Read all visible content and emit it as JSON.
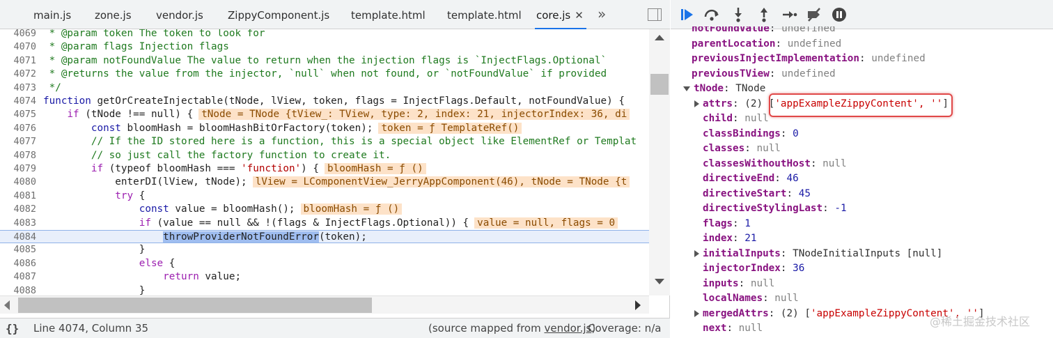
{
  "tabs": [
    {
      "label": "main.js"
    },
    {
      "label": "zone.js"
    },
    {
      "label": "vendor.js"
    },
    {
      "label": "ZippyComponent.js"
    },
    {
      "label": "template.html"
    },
    {
      "label": "template.html"
    },
    {
      "label": "core.js",
      "active": true,
      "close": "✕"
    }
  ],
  "tab_overflow": "»",
  "code_lines": [
    {
      "n": "4069",
      "text": " * @param token The token to look for"
    },
    {
      "n": "4070",
      "text": " * @param flags Injection flags"
    },
    {
      "n": "4071",
      "text": " * @param notFoundValue The value to return when the injection flags is `InjectFlags.Optional`"
    },
    {
      "n": "4072",
      "text": " * @returns the value from the injector, `null` when not found, or `notFoundValue` if provided"
    },
    {
      "n": "4073",
      "text": " */"
    },
    {
      "n": "4074",
      "kw": "function",
      "text": " getOrCreateInjectable(tNode, lView, token, flags = InjectFlags.Default, notFoundValue) {"
    },
    {
      "n": "4075",
      "pre": "    ",
      "kw": "if",
      "text": " (tNode !== null) {",
      "inline": "tNode = TNode {tView_: TView, type: 2, index: 21, injectorIndex: 36, di"
    },
    {
      "n": "4076",
      "pre": "        ",
      "kw": "const",
      "text": " bloomHash = bloomHashBitOrFactory(token);",
      "inline": "token = ƒ TemplateRef()"
    },
    {
      "n": "4077",
      "text": "        // If the ID stored here is a function, this is a special object like ElementRef or Templat"
    },
    {
      "n": "4078",
      "text": "        // so just call the factory function to create it."
    },
    {
      "n": "4079",
      "pre": "        ",
      "kw": "if",
      "text": " (typeof bloomHash === ",
      "str": "'function'",
      "post": ") {",
      "inline": "bloomHash = ƒ ()"
    },
    {
      "n": "4080",
      "pre": "            ",
      "text": "enterDI(lView, tNode);",
      "inline": "lView = LComponentView_JerryAppComponent(46), tNode = TNode {t"
    },
    {
      "n": "4081",
      "pre": "            ",
      "kw": "try",
      "text": " {"
    },
    {
      "n": "4082",
      "pre": "                ",
      "kw": "const",
      "text": " value = bloomHash();",
      "inline": "bloomHash = ƒ ()"
    },
    {
      "n": "4083",
      "pre": "                ",
      "kw": "if",
      "text": " (value == null && !(flags & InjectFlags.Optional)) {",
      "inline": "value = null, flags = 0"
    },
    {
      "n": "4084",
      "pre": "                    ",
      "sel": "throwProviderNotFoundError",
      "text": "(token);"
    },
    {
      "n": "4085",
      "text": "                }"
    },
    {
      "n": "4086",
      "pre": "                ",
      "kw": "else",
      "text": " {"
    },
    {
      "n": "4087",
      "pre": "                    ",
      "kw": "return",
      "text": " value;"
    },
    {
      "n": "4088",
      "text": "                }"
    }
  ],
  "status": {
    "cursor": "Line 4074, Column 35",
    "source_prefix": "(source mapped from ",
    "source_file": "vendor.js",
    "source_suffix": ")",
    "coverage": "Coverage: n/a"
  },
  "scope": [
    {
      "key": "notFoundValue",
      "val": "undefined",
      "vclass": "undef",
      "depth": 0
    },
    {
      "key": "parentLocation",
      "val": "undefined",
      "vclass": "undef",
      "depth": 0
    },
    {
      "key": "previousInjectImplementation",
      "val": "undefined",
      "vclass": "undef",
      "depth": 0
    },
    {
      "key": "previousTView",
      "val": "undefined",
      "vclass": "undef",
      "depth": 0
    },
    {
      "key": "tNode",
      "val": "TNode",
      "vclass": "obj",
      "depth": 0,
      "arrow": "down"
    },
    {
      "key": "attrs",
      "val": "(2) ['appExampleZippyContent', '']",
      "vclass": "attrs",
      "depth": 1,
      "arrow": "right"
    },
    {
      "key": "child",
      "val": "null",
      "vclass": "null",
      "depth": 1
    },
    {
      "key": "classBindings",
      "val": "0",
      "vclass": "num",
      "depth": 1
    },
    {
      "key": "classes",
      "val": "null",
      "vclass": "null",
      "depth": 1
    },
    {
      "key": "classesWithoutHost",
      "val": "null",
      "vclass": "null",
      "depth": 1
    },
    {
      "key": "directiveEnd",
      "val": "46",
      "vclass": "num",
      "depth": 1
    },
    {
      "key": "directiveStart",
      "val": "45",
      "vclass": "num",
      "depth": 1
    },
    {
      "key": "directiveStylingLast",
      "val": "-1",
      "vclass": "num",
      "depth": 1
    },
    {
      "key": "flags",
      "val": "1",
      "vclass": "num",
      "depth": 1
    },
    {
      "key": "index",
      "val": "21",
      "vclass": "num",
      "depth": 1
    },
    {
      "key": "initialInputs",
      "val": "TNodeInitialInputs [null]",
      "vclass": "obj",
      "depth": 1,
      "arrow": "right"
    },
    {
      "key": "injectorIndex",
      "val": "36",
      "vclass": "num",
      "depth": 1
    },
    {
      "key": "inputs",
      "val": "null",
      "vclass": "null",
      "depth": 1
    },
    {
      "key": "localNames",
      "val": "null",
      "vclass": "null",
      "depth": 1
    },
    {
      "key": "mergedAttrs",
      "val": "(2) ['appExampleZippyContent', '']",
      "vclass": "attrs",
      "depth": 1,
      "arrow": "right"
    },
    {
      "key": "next",
      "val": "null",
      "vclass": "null",
      "depth": 1
    }
  ],
  "watermark": "@稀土掘金技术社区",
  "colors": {
    "accent": "#1a73e8",
    "highlight_ring": "#e04848",
    "inline_bg": "#fde2c8"
  }
}
